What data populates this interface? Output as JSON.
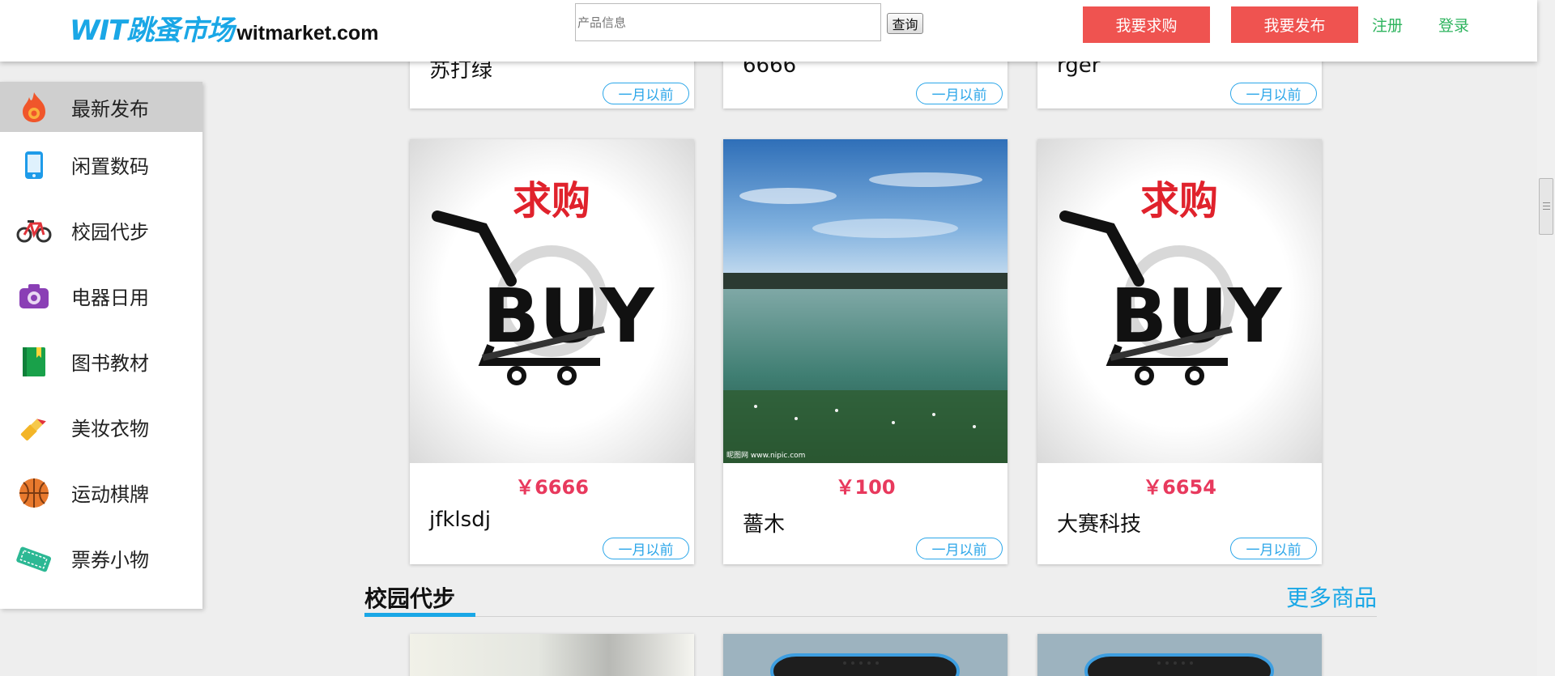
{
  "header": {
    "logo_brand": "WIT跳蚤市场",
    "logo_domain": "witmarket.com",
    "search_placeholder": "产品信息",
    "search_button": "查询",
    "want_buy_button": "我要求购",
    "want_publish_button": "我要发布",
    "register_link": "注册",
    "login_link": "登录"
  },
  "sidebar": {
    "items": [
      {
        "label": "最新发布",
        "icon": "fire-icon",
        "active": true
      },
      {
        "label": "闲置数码",
        "icon": "phone-icon"
      },
      {
        "label": "校园代步",
        "icon": "bicycle-icon"
      },
      {
        "label": "电器日用",
        "icon": "camera-icon"
      },
      {
        "label": "图书教材",
        "icon": "book-icon"
      },
      {
        "label": "美妆衣物",
        "icon": "lipstick-icon"
      },
      {
        "label": "运动棋牌",
        "icon": "basketball-icon"
      },
      {
        "label": "票券小物",
        "icon": "ticket-icon"
      }
    ]
  },
  "products_top_row": [
    {
      "name": "苏打绿",
      "time": "一月以前"
    },
    {
      "name": "6666",
      "time": "一月以前"
    },
    {
      "name": "rger",
      "time": "一月以前"
    }
  ],
  "products_main_row": [
    {
      "image": "buy-cart",
      "image_text": "求购",
      "price": "￥6666",
      "name": "jfklsdj",
      "time": "一月以前"
    },
    {
      "image": "lake-photo",
      "image_text": "昵图网 www.nipic.com",
      "price": "￥100",
      "name": "薔木",
      "time": "一月以前"
    },
    {
      "image": "buy-cart",
      "image_text": "求购",
      "price": "￥6654",
      "name": "大赛科技",
      "time": "一月以前"
    }
  ],
  "section": {
    "title": "校园代步",
    "more_link": "更多商品"
  },
  "colors": {
    "brand_blue": "#1aa7e6",
    "action_red": "#ef5350",
    "link_green": "#2db35d",
    "price_pink": "#e8395d"
  }
}
